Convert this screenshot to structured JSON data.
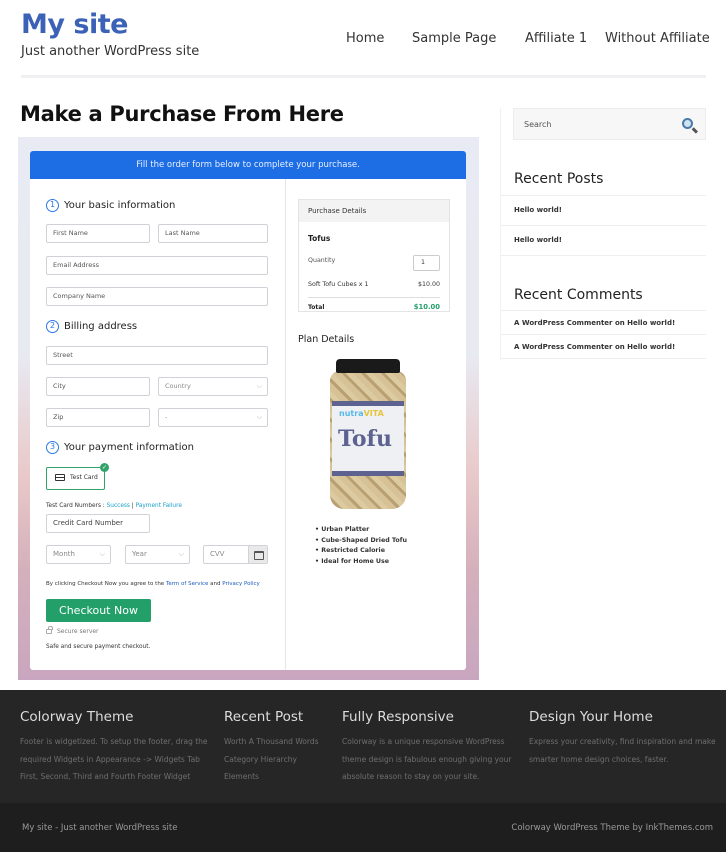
{
  "header": {
    "site_title": "My site",
    "tagline": "Just another WordPress site",
    "nav": [
      "Home",
      "Sample Page",
      "Affiliate 1",
      "Without Affiliate"
    ]
  },
  "page": {
    "title": "Make a Purchase From Here"
  },
  "form": {
    "banner": "Fill the order form below to complete your purchase.",
    "step1": {
      "num": "1",
      "label": "Your basic information"
    },
    "step2": {
      "num": "2",
      "label": "Billing address"
    },
    "step3": {
      "num": "3",
      "label": "Your payment information"
    },
    "placeholders": {
      "first_name": "First Name",
      "last_name": "Last Name",
      "email": "Email Address",
      "company": "Company Name",
      "street": "Street",
      "city": "City",
      "country": "Country",
      "zip": "Zip",
      "state": "-",
      "card_number": "Credit Card Number",
      "month": "Month",
      "year": "Year",
      "cvv": "CVV"
    },
    "payment_option": "Test Card",
    "test_cards_label": "Test Card Numbers : ",
    "test_success": "Success",
    "test_sep": " | ",
    "test_failure": "Payment Failure",
    "agree_prefix": "By clicking Checkout Now you agree to the ",
    "terms": "Term of Service",
    "and": " and ",
    "privacy": "Privacy Policy",
    "checkout_button": "Checkout Now",
    "secure_server": "Secure server",
    "safe_text": "Safe and secure payment checkout."
  },
  "purchase": {
    "heading": "Purchase Details",
    "product": "Tofus",
    "quantity_label": "Quantity",
    "quantity_value": "1",
    "line_item": "Soft Tofu Cubes x 1",
    "line_price": "$10.00",
    "total_label": "Total",
    "total_value": "$10.00",
    "plan_heading": "Plan Details",
    "jar_brand_1": "nutra",
    "jar_brand_2": "VITA",
    "jar_word": "Tofu",
    "features": [
      "• Urban Platter",
      "• Cube-Shaped Dried Tofu",
      "• Restricted Calorie",
      "• Ideal for Home Use"
    ]
  },
  "sidebar": {
    "search_placeholder": "Search",
    "recent_posts_title": "Recent Posts",
    "recent_posts": [
      "Hello world!",
      "Hello world!"
    ],
    "recent_comments_title": "Recent Comments",
    "recent_comments": [
      "A WordPress Commenter on Hello world!",
      "A WordPress Commenter on Hello world!"
    ]
  },
  "footer": {
    "cols": [
      {
        "title": "Colorway Theme",
        "lines": [
          "Footer is widgetized. To setup the footer, drag the",
          "required Widgets in Appearance -> Widgets Tab",
          "First, Second, Third and Fourth Footer Widget"
        ]
      },
      {
        "title": "Recent Post",
        "lines": [
          "Worth A Thousand Words",
          "Category Hierarchy",
          "Elements"
        ]
      },
      {
        "title": "Fully Responsive",
        "lines": [
          "Colorway is a unique responsive WordPress",
          "theme design is fabulous enough giving your",
          "absolute reason to stay on your site."
        ]
      },
      {
        "title": "Design Your Home",
        "lines": [
          "Express your creativity, find inspiration and make",
          "smarter home design choices, faster."
        ]
      }
    ],
    "bottom_left": "My site - Just another WordPress site",
    "bottom_right": "Colorway WordPress Theme by InkThemes.com"
  }
}
